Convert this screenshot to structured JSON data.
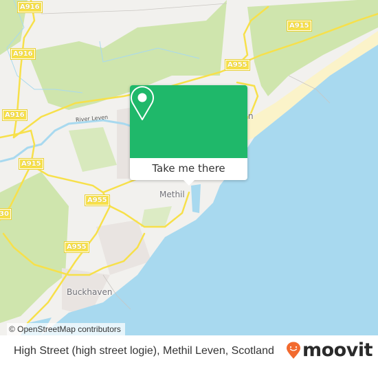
{
  "map": {
    "road_labels": [
      {
        "id": "a916-top",
        "text": "A916"
      },
      {
        "id": "a916-mid",
        "text": "A916"
      },
      {
        "id": "a916-left",
        "text": "A916"
      },
      {
        "id": "a915-top",
        "text": "A915"
      },
      {
        "id": "a955-top",
        "text": "A955"
      },
      {
        "id": "a915-left",
        "text": "A915"
      },
      {
        "id": "a955-mid",
        "text": "A955"
      },
      {
        "id": "a955-low",
        "text": "A955"
      },
      {
        "id": "a930-edge",
        "text": "30"
      }
    ],
    "place_labels": {
      "methil": "Methil",
      "buckhaven": "Buckhaven",
      "leven_partial": "n"
    },
    "river_label": "River Leven",
    "colors": {
      "water": "#a8d9ef",
      "park": "#cfe5ad",
      "sand": "#fbf3c9",
      "land": "#f2f1ee",
      "road": "#f7e04a",
      "accent": "#1fb86a"
    }
  },
  "popup": {
    "icon": "map-pin-icon",
    "button_label": "Take me there"
  },
  "attribution": "© OpenStreetMap contributors",
  "footer": {
    "location_text": "High Street (high street logie), Methil Leven, Scotland",
    "brand_icon": "moovit-pin-icon",
    "brand_name": "moovit",
    "brand_color": "#f26a2e"
  }
}
